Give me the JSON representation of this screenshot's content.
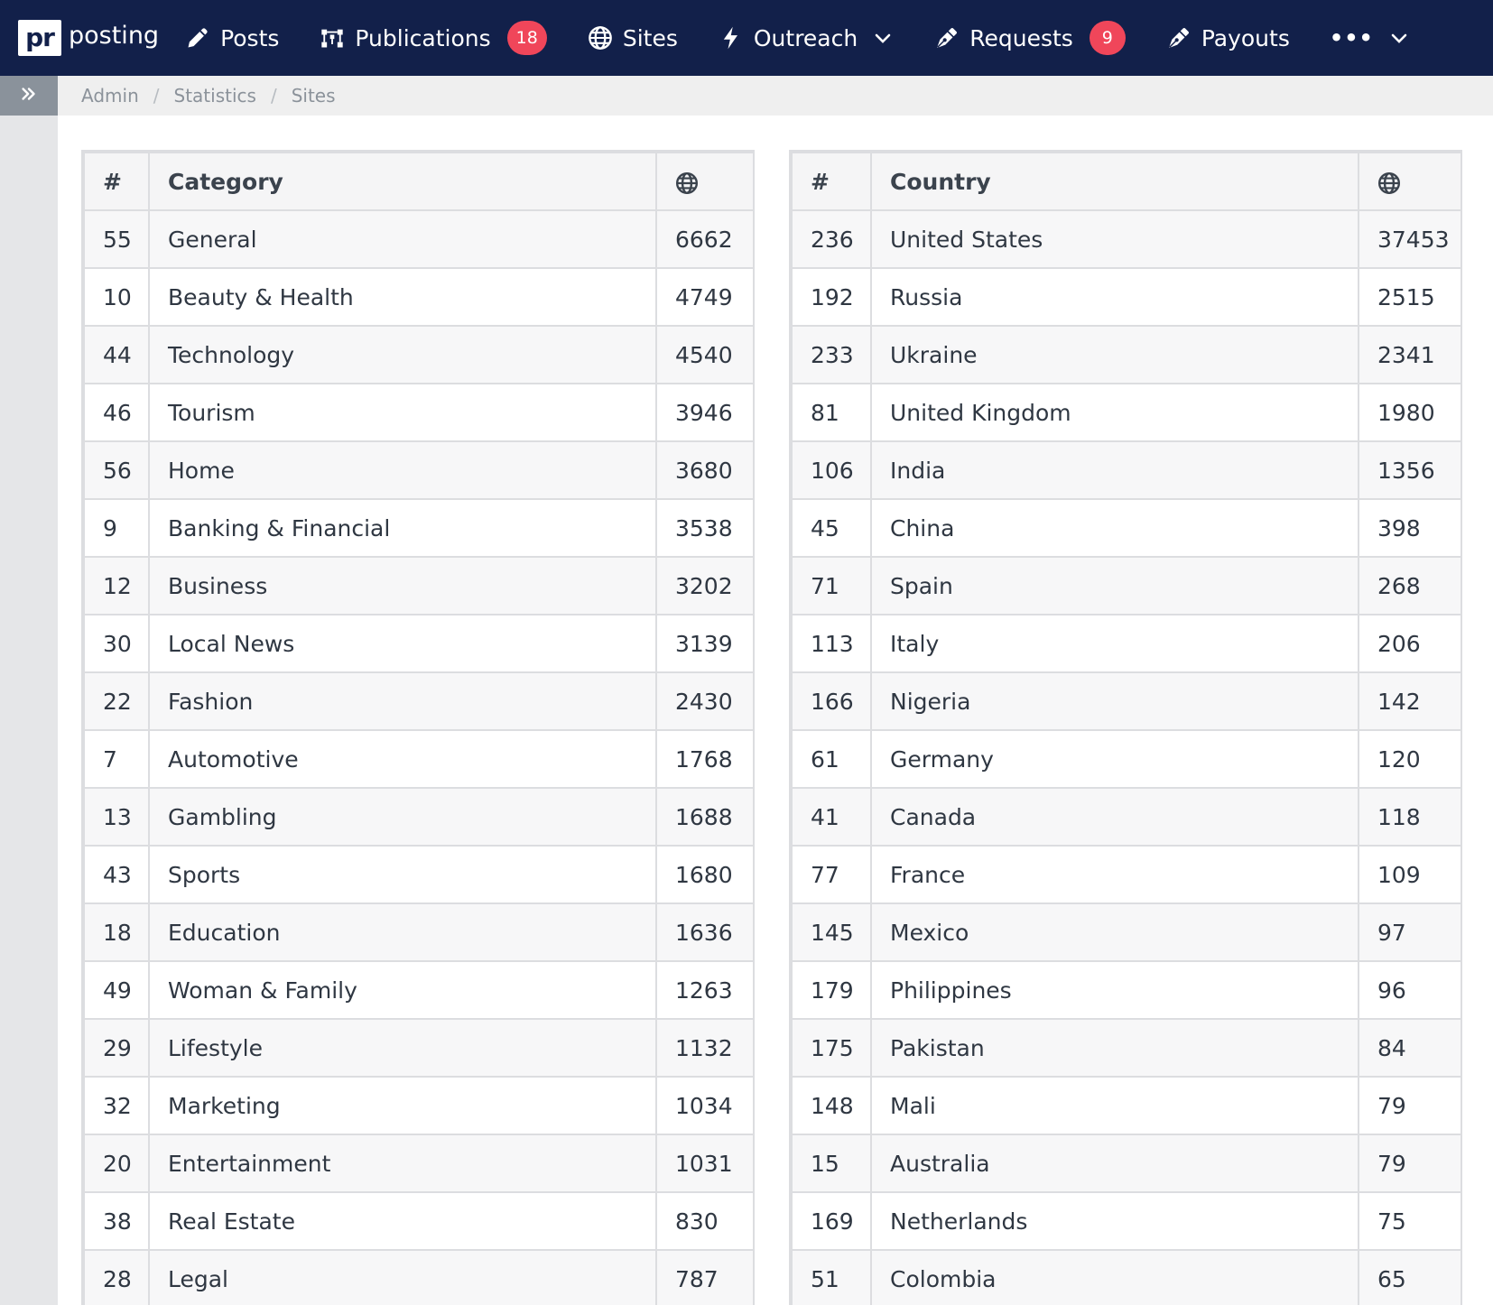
{
  "app": {
    "logo_mark": "pr",
    "logo_text": "posting"
  },
  "nav": {
    "items": [
      {
        "label": "Posts",
        "icon": "pencil-icon"
      },
      {
        "label": "Publications",
        "icon": "nodes-icon",
        "badge": "18"
      },
      {
        "label": "Sites",
        "icon": "globe-icon"
      },
      {
        "label": "Outreach",
        "icon": "bolt-icon",
        "dropdown": true
      },
      {
        "label": "Requests",
        "icon": "pen-nib-icon",
        "badge": "9"
      },
      {
        "label": "Payouts",
        "icon": "pen-nib-icon"
      }
    ],
    "more_label": "•••"
  },
  "breadcrumb": [
    "Admin",
    "Statistics",
    "Sites"
  ],
  "category_table": {
    "headers": {
      "id": "#",
      "name": "Category",
      "count_icon": "globe-icon"
    },
    "rows": [
      {
        "id": "55",
        "name": "General",
        "count": "6662"
      },
      {
        "id": "10",
        "name": "Beauty & Health",
        "count": "4749"
      },
      {
        "id": "44",
        "name": "Technology",
        "count": "4540"
      },
      {
        "id": "46",
        "name": "Tourism",
        "count": "3946"
      },
      {
        "id": "56",
        "name": "Home",
        "count": "3680"
      },
      {
        "id": "9",
        "name": "Banking & Financial",
        "count": "3538"
      },
      {
        "id": "12",
        "name": "Business",
        "count": "3202"
      },
      {
        "id": "30",
        "name": "Local News",
        "count": "3139"
      },
      {
        "id": "22",
        "name": "Fashion",
        "count": "2430"
      },
      {
        "id": "7",
        "name": "Automotive",
        "count": "1768"
      },
      {
        "id": "13",
        "name": "Gambling",
        "count": "1688"
      },
      {
        "id": "43",
        "name": "Sports",
        "count": "1680"
      },
      {
        "id": "18",
        "name": "Education",
        "count": "1636"
      },
      {
        "id": "49",
        "name": "Woman & Family",
        "count": "1263"
      },
      {
        "id": "29",
        "name": "Lifestyle",
        "count": "1132"
      },
      {
        "id": "32",
        "name": "Marketing",
        "count": "1034"
      },
      {
        "id": "20",
        "name": "Entertainment",
        "count": "1031"
      },
      {
        "id": "38",
        "name": "Real Estate",
        "count": "830"
      },
      {
        "id": "28",
        "name": "Legal",
        "count": "787"
      }
    ]
  },
  "country_table": {
    "headers": {
      "id": "#",
      "name": "Country",
      "count_icon": "globe-icon"
    },
    "rows": [
      {
        "id": "236",
        "name": "United States",
        "count": "37453"
      },
      {
        "id": "192",
        "name": "Russia",
        "count": "2515"
      },
      {
        "id": "233",
        "name": "Ukraine",
        "count": "2341"
      },
      {
        "id": "81",
        "name": "United Kingdom",
        "count": "1980"
      },
      {
        "id": "106",
        "name": "India",
        "count": "1356"
      },
      {
        "id": "45",
        "name": "China",
        "count": "398"
      },
      {
        "id": "71",
        "name": "Spain",
        "count": "268"
      },
      {
        "id": "113",
        "name": "Italy",
        "count": "206"
      },
      {
        "id": "166",
        "name": "Nigeria",
        "count": "142"
      },
      {
        "id": "61",
        "name": "Germany",
        "count": "120"
      },
      {
        "id": "41",
        "name": "Canada",
        "count": "118"
      },
      {
        "id": "77",
        "name": "France",
        "count": "109"
      },
      {
        "id": "145",
        "name": "Mexico",
        "count": "97"
      },
      {
        "id": "179",
        "name": "Philippines",
        "count": "96"
      },
      {
        "id": "175",
        "name": "Pakistan",
        "count": "84"
      },
      {
        "id": "148",
        "name": "Mali",
        "count": "79"
      },
      {
        "id": "15",
        "name": "Australia",
        "count": "79"
      },
      {
        "id": "169",
        "name": "Netherlands",
        "count": "75"
      },
      {
        "id": "51",
        "name": "Colombia",
        "count": "65"
      }
    ]
  },
  "colors": {
    "navbar_bg": "#12204a",
    "badge": "#f0465a",
    "sidebar_toggle": "#8a929b"
  }
}
